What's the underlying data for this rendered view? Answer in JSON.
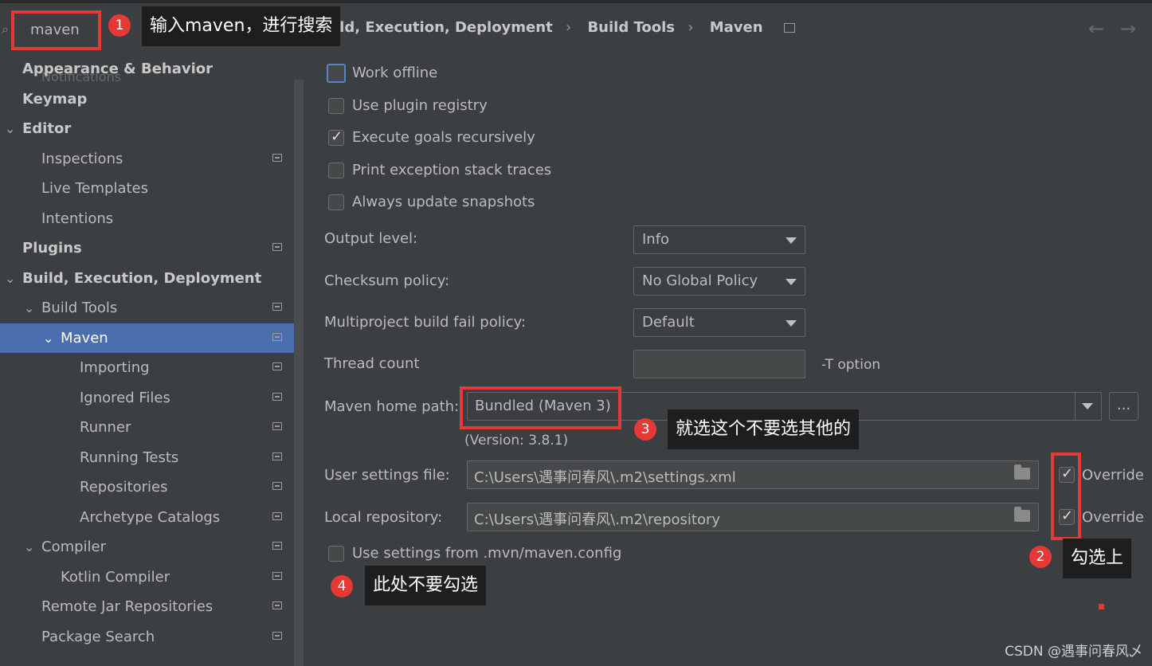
{
  "search": {
    "value": "maven"
  },
  "sidebar": {
    "ghost_text": "Notifications",
    "items": [
      {
        "label": "Appearance & Behavior",
        "level": 0,
        "bold": true,
        "arrow": "",
        "gear": false
      },
      {
        "label": "Keymap",
        "level": 0,
        "bold": true,
        "arrow": "",
        "gear": false
      },
      {
        "label": "Editor",
        "level": 0,
        "bold": true,
        "arrow": "expanded",
        "gear": false
      },
      {
        "label": "Inspections",
        "level": 1,
        "bold": false,
        "arrow": "",
        "gear": true
      },
      {
        "label": "Live Templates",
        "level": 1,
        "bold": false,
        "arrow": "",
        "gear": false
      },
      {
        "label": "Intentions",
        "level": 1,
        "bold": false,
        "arrow": "",
        "gear": false
      },
      {
        "label": "Plugins",
        "level": 0,
        "bold": true,
        "arrow": "",
        "gear": true
      },
      {
        "label": "Build, Execution, Deployment",
        "level": 0,
        "bold": true,
        "arrow": "expanded",
        "gear": false
      },
      {
        "label": "Build Tools",
        "level": 1,
        "bold": false,
        "arrow": "expanded",
        "gear": true
      },
      {
        "label": "Maven",
        "level": 2,
        "bold": false,
        "arrow": "expanded",
        "gear": true,
        "selected": true
      },
      {
        "label": "Importing",
        "level": 3,
        "bold": false,
        "arrow": "",
        "gear": true
      },
      {
        "label": "Ignored Files",
        "level": 3,
        "bold": false,
        "arrow": "",
        "gear": true
      },
      {
        "label": "Runner",
        "level": 3,
        "bold": false,
        "arrow": "",
        "gear": true
      },
      {
        "label": "Running Tests",
        "level": 3,
        "bold": false,
        "arrow": "",
        "gear": true
      },
      {
        "label": "Repositories",
        "level": 3,
        "bold": false,
        "arrow": "",
        "gear": true
      },
      {
        "label": "Archetype Catalogs",
        "level": 3,
        "bold": false,
        "arrow": "",
        "gear": true
      },
      {
        "label": "Compiler",
        "level": 1,
        "bold": false,
        "arrow": "expanded",
        "gear": true
      },
      {
        "label": "Kotlin Compiler",
        "level": 2,
        "bold": false,
        "arrow": "",
        "gear": true
      },
      {
        "label": "Remote Jar Repositories",
        "level": 1,
        "bold": false,
        "arrow": "",
        "gear": true
      },
      {
        "label": "Package Search",
        "level": 1,
        "bold": false,
        "arrow": "",
        "gear": true
      }
    ]
  },
  "header": {
    "breadcrumb": [
      "ild, Execution, Deployment",
      "Build Tools",
      "Maven"
    ],
    "separator": "›",
    "back_arrow": "←",
    "forward_arrow": "→"
  },
  "checkboxes": [
    {
      "label": "Work offline",
      "checked": false
    },
    {
      "label": "Use plugin registry",
      "checked": false
    },
    {
      "label": "Execute goals recursively",
      "checked": true
    },
    {
      "label": "Print exception stack traces",
      "checked": false
    },
    {
      "label": "Always update snapshots",
      "checked": false
    }
  ],
  "form": {
    "output_level": {
      "label": "Output level:",
      "value": "Info"
    },
    "checksum_policy": {
      "label": "Checksum policy:",
      "value": "No Global Policy"
    },
    "fail_policy": {
      "label": "Multiproject build fail policy:",
      "value": "Default"
    },
    "thread_count": {
      "label": "Thread count",
      "value": "",
      "hint": "-T option"
    },
    "maven_home": {
      "label": "Maven home path:",
      "value": "Bundled (Maven 3)",
      "version": "(Version: 3.8.1)",
      "browse": "..."
    },
    "user_settings": {
      "label": "User settings file:",
      "value": "C:\\Users\\遇事问春风\\.m2\\settings.xml",
      "override_label": "Override",
      "override": true
    },
    "local_repo": {
      "label": "Local repository:",
      "value": "C:\\Users\\遇事问春风\\.m2\\repository",
      "override_label": "Override",
      "override": true
    },
    "mvn_config": {
      "label": "Use settings from .mvn/maven.config",
      "checked": false
    }
  },
  "annotations": {
    "badge1": "1",
    "note1": "输入maven，进行搜索",
    "badge2": "2",
    "note2": "勾选上",
    "badge3": "3",
    "note3": "就选这个不要选其他的",
    "badge4": "4",
    "note4": "此处不要勾选",
    "accent": "#e53935"
  },
  "watermark": "CSDN @遇事问春风乄"
}
